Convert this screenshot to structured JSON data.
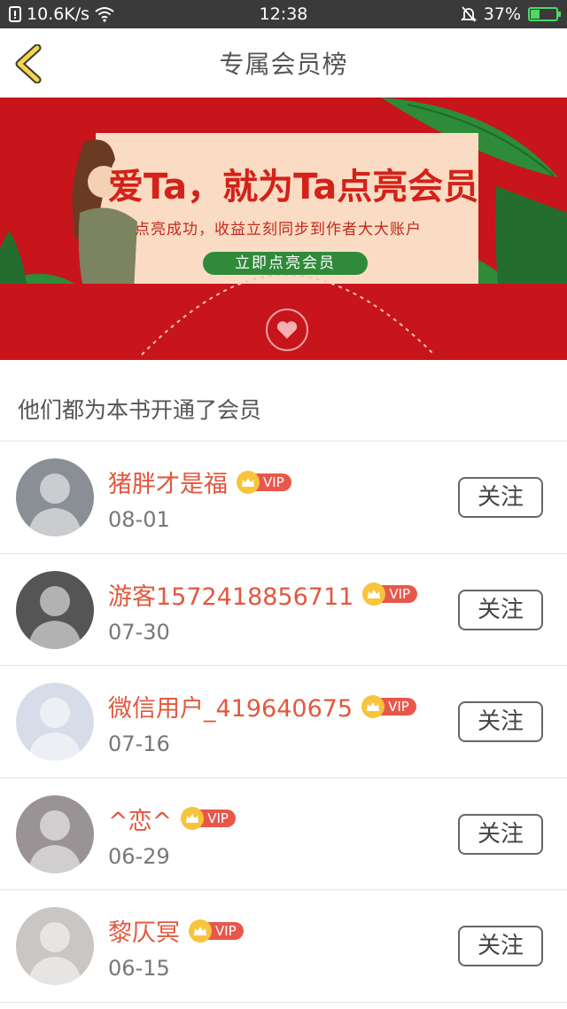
{
  "status_bar": {
    "network_speed": "10.6K/s",
    "time": "12:38",
    "battery_percent": "37%",
    "battery_level": 0.37
  },
  "nav": {
    "title": "专属会员榜"
  },
  "banner": {
    "headline": "爱Ta，就为Ta点亮会员",
    "subtitle": "点亮成功，收益立刻同步到作者大大账户",
    "cta_label": "立即点亮会员"
  },
  "section": {
    "title": "他们都为本书开通了会员"
  },
  "vip_label": "VIP",
  "follow_label": "关注",
  "members": [
    {
      "name": "猪胖才是福",
      "date": "08-01",
      "avatar_icon": "photo-avatar",
      "avatar_color": "#8a8f96"
    },
    {
      "name": "游客1572418856711",
      "date": "07-30",
      "avatar_icon": "photo-avatar",
      "avatar_color": "#555555"
    },
    {
      "name": "微信用户_419640675",
      "date": "07-16",
      "avatar_icon": "default-person-avatar",
      "avatar_color": "#d6dde9"
    },
    {
      "name": "^恋^",
      "date": "06-29",
      "avatar_icon": "cartoon-avatar",
      "avatar_color": "#9a9396"
    },
    {
      "name": "黎仄冥",
      "date": "06-15",
      "avatar_icon": "photo-avatar",
      "avatar_color": "#c9c6c3"
    }
  ]
}
